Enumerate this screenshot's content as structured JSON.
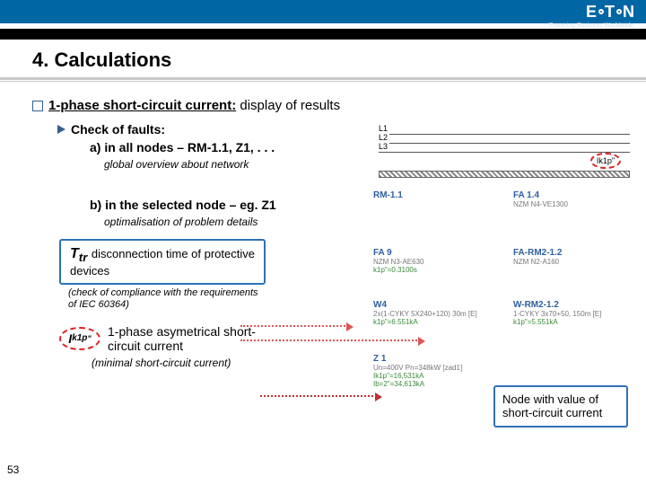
{
  "brand": "E·T·N",
  "tagline": "Powering Business Worldwide",
  "title": "4. Calculations",
  "heading_underline": "1-phase short-circuit current:",
  "heading_rest": " display of results",
  "check_faults": "Check of faults:",
  "item_a": "a) in all nodes – RM-1.1, Z1, . . .",
  "note_a": "global overview about network",
  "item_b": "b) in the selected node – eg. Z1",
  "note_b": "optimalisation of problem details",
  "ttr_label_sym": "T",
  "ttr_label_sub": "tr",
  "ttr_text": " disconnection time of protective   devices",
  "ttr_check": "(check of compliance with the requirements of IEC 60364)",
  "ik_sym": "I",
  "ik_sub": "k1p",
  "ik_sup": "\"",
  "ik_text": "1-phase asymetrical short-circuit current",
  "ik_min": "(minimal short-circuit current)",
  "node_box": "Node with value of short-circuit current",
  "page": "53",
  "phases": {
    "L1": "L1",
    "L2": "L2",
    "L3": "L3"
  },
  "ik_small": "Ik1p\"",
  "diagram": {
    "rm11": {
      "label": "RM-1.1"
    },
    "fa14": {
      "label": "FA 1.4",
      "sub": "NZM N4-VE1300"
    },
    "fa9": {
      "label": "FA 9",
      "sub": "NZM N3-AE630",
      "kp": "k1p\"=0.3100s"
    },
    "farm": {
      "label": "FA-RM2-1.2",
      "sub": "NZM N2-A160"
    },
    "w4": {
      "label": "W4",
      "sub": "2x(1-CYKY 5X240+120) 30m [E]",
      "kp": "k1p\"=6.551kA"
    },
    "wrm": {
      "label": "W-RM2-1.2",
      "sub": "1-CYKY 3x70+50, 150m [E]",
      "kp": "k1p\"=5.551kA"
    },
    "z1": {
      "label": "Z 1",
      "un": "Un=400V  Pn=348kW [zad1]",
      "ik": "Ik1p\"=16,531kA",
      "ib": "Ib=2\"=34,613kA"
    }
  }
}
